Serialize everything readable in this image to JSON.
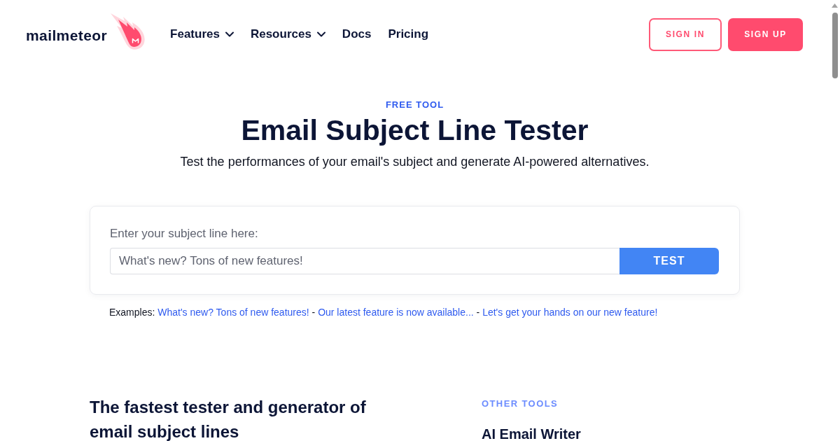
{
  "header": {
    "logo": {
      "text": "mailmeteor"
    },
    "nav": [
      {
        "label": "Features",
        "dropdown": true
      },
      {
        "label": "Resources",
        "dropdown": true
      },
      {
        "label": "Docs",
        "dropdown": false
      },
      {
        "label": "Pricing",
        "dropdown": false
      }
    ],
    "actions": [
      {
        "label": "SIGN IN",
        "kind": "outline"
      },
      {
        "label": "SIGN UP",
        "kind": "filled"
      }
    ]
  },
  "hero": {
    "eyebrow": "FREE TOOL",
    "title": "Email Subject Line Tester",
    "subtitle": "Test the performances of your email's subject and generate AI-powered alternatives."
  },
  "tester": {
    "label": "Enter your subject line here:",
    "input": {
      "placeholder": "What's new? Tons of new features!"
    },
    "button": "TEST"
  },
  "examples": {
    "label": "Examples:",
    "separator": "-",
    "links": [
      "What's new? Tons of new features!",
      "Our latest feature is now available...",
      "Let's get your hands on our new feature!"
    ]
  },
  "about": {
    "heading": "The fastest tester and generator of email subject lines"
  },
  "other_tools": {
    "heading": "OTHER TOOLS",
    "items": [
      "AI Email Writer"
    ]
  }
}
